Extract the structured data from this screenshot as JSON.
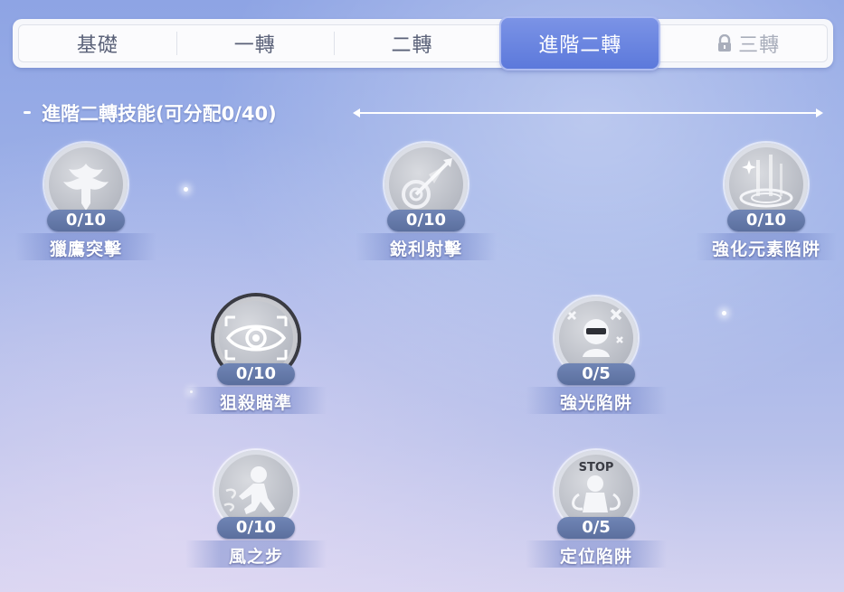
{
  "tabs": [
    {
      "label": "基礎",
      "state": "normal"
    },
    {
      "label": "一轉",
      "state": "normal"
    },
    {
      "label": "二轉",
      "state": "normal"
    },
    {
      "label": "進階二轉",
      "state": "active"
    },
    {
      "label": "三轉",
      "state": "locked",
      "icon": "lock-icon"
    }
  ],
  "section": {
    "title": "進階二轉技能(可分配0/40)"
  },
  "skills": [
    {
      "name": "獵鷹突擊",
      "level": "0/10",
      "icon": "eagle-icon"
    },
    {
      "name": "銳利射擊",
      "level": "0/10",
      "icon": "arrow-shot-icon"
    },
    {
      "name": "強化元素陷阱",
      "level": "0/10",
      "icon": "element-trap-icon"
    },
    {
      "name": "狙殺瞄準",
      "level": "0/10",
      "icon": "eye-target-icon"
    },
    {
      "name": "強光陷阱",
      "level": "0/5",
      "icon": "flash-trap-icon"
    },
    {
      "name": "風之步",
      "level": "0/10",
      "icon": "wind-step-icon"
    },
    {
      "name": "定位陷阱",
      "level": "0/5",
      "icon": "stop-trap-icon",
      "icon_text": "STOP"
    }
  ],
  "colors": {
    "active_tab": "#5c79db",
    "level_badge": "#6679a8",
    "background_top": "#8ea4e4",
    "background_bottom": "#d5d3f0"
  }
}
